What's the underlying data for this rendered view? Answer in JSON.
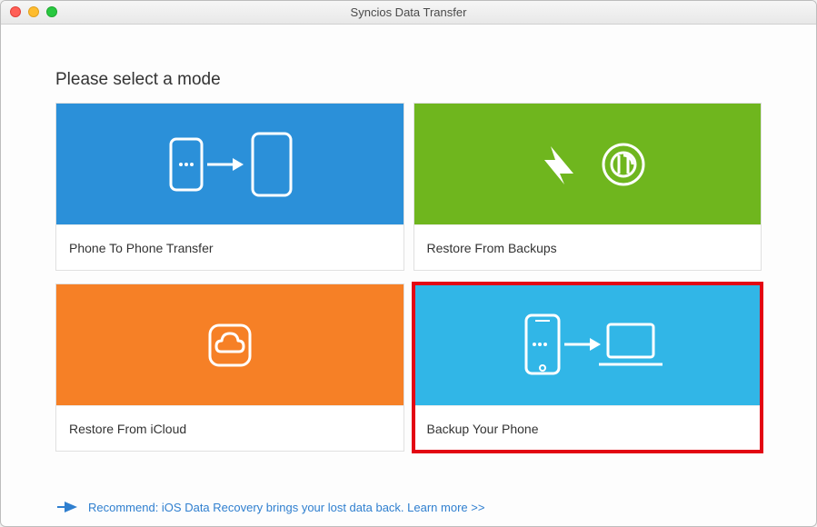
{
  "window": {
    "title": "Syncios Data Transfer"
  },
  "heading": "Please select a mode",
  "cards": {
    "transfer": {
      "label": "Phone To Phone Transfer"
    },
    "restore_backup": {
      "label": "Restore From Backups"
    },
    "restore_icloud": {
      "label": "Restore From iCloud"
    },
    "backup_phone": {
      "label": "Backup Your Phone"
    }
  },
  "recommend": {
    "text": "Recommend: iOS Data Recovery brings your lost data back. Learn more >>"
  }
}
